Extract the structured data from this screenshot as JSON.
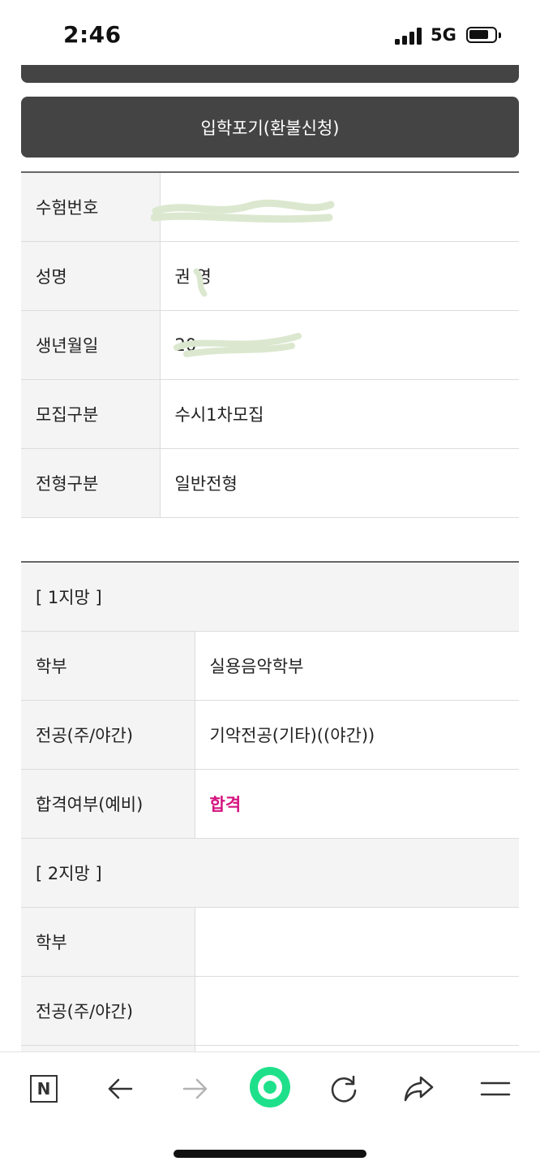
{
  "status_bar": {
    "time": "2:46",
    "network": "5G"
  },
  "refund_button": {
    "label": "입학포기(환불신청)"
  },
  "applicant": {
    "rows": [
      {
        "label": "수험번호",
        "value": ""
      },
      {
        "label": "성명",
        "value": "권 영"
      },
      {
        "label": "생년월일",
        "value": "20"
      },
      {
        "label": "모집구분",
        "value": "수시1차모집"
      },
      {
        "label": "전형구분",
        "value": "일반전형"
      }
    ]
  },
  "choice1": {
    "title": "[ 1지망 ]",
    "rows": [
      {
        "label": "학부",
        "value": "실용음악학부"
      },
      {
        "label": "전공(주/야간)",
        "value": "기악전공(기타)((야간))"
      },
      {
        "label": "합격여부(예비)",
        "value": "합격"
      }
    ]
  },
  "choice2": {
    "title": "[ 2지망 ]",
    "rows": [
      {
        "label": "학부",
        "value": ""
      },
      {
        "label": "전공(주/야간)",
        "value": ""
      }
    ]
  },
  "toolbar": {
    "icons": [
      "naver-n-icon",
      "back-arrow-icon",
      "forward-arrow-icon",
      "home-circle-icon",
      "refresh-icon",
      "share-icon",
      "menu-icon"
    ]
  },
  "colors": {
    "button_bg": "#444444",
    "pass_text": "#d4137f",
    "toolbar_accent": "#1fe08a"
  }
}
